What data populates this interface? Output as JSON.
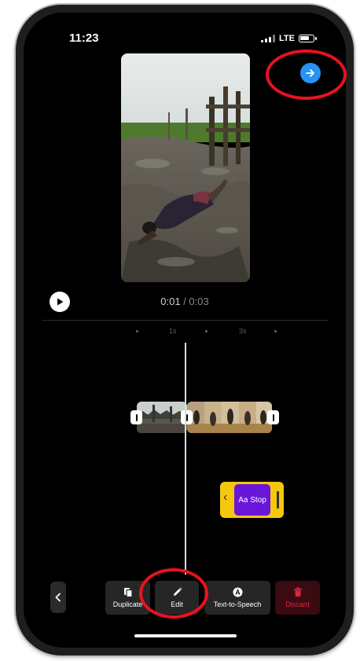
{
  "status_bar": {
    "time": "11:23",
    "network": "LTE"
  },
  "playback": {
    "current_time": "0:01",
    "separator": " / ",
    "total_time": "0:03"
  },
  "timeline": {
    "ruler_labels": [
      "1s",
      "3s"
    ]
  },
  "text_track": {
    "icon_text": "Aa",
    "label": "Stop"
  },
  "toolbar": {
    "duplicate_label": "Duplicate",
    "edit_label": "Edit",
    "tts_label": "Text-to-Speech",
    "discard_label": "Discard"
  },
  "colors": {
    "accent": "#2693f6",
    "text_track": "#f5c80c",
    "text_chip": "#6a16d9",
    "discard": "#e0243a",
    "annotation": "#e8121e"
  },
  "icons": [
    "arrow-right-icon",
    "play-icon",
    "copy-icon",
    "pencil-icon",
    "text-to-speech-icon",
    "trash-icon",
    "chevron-left-icon"
  ]
}
